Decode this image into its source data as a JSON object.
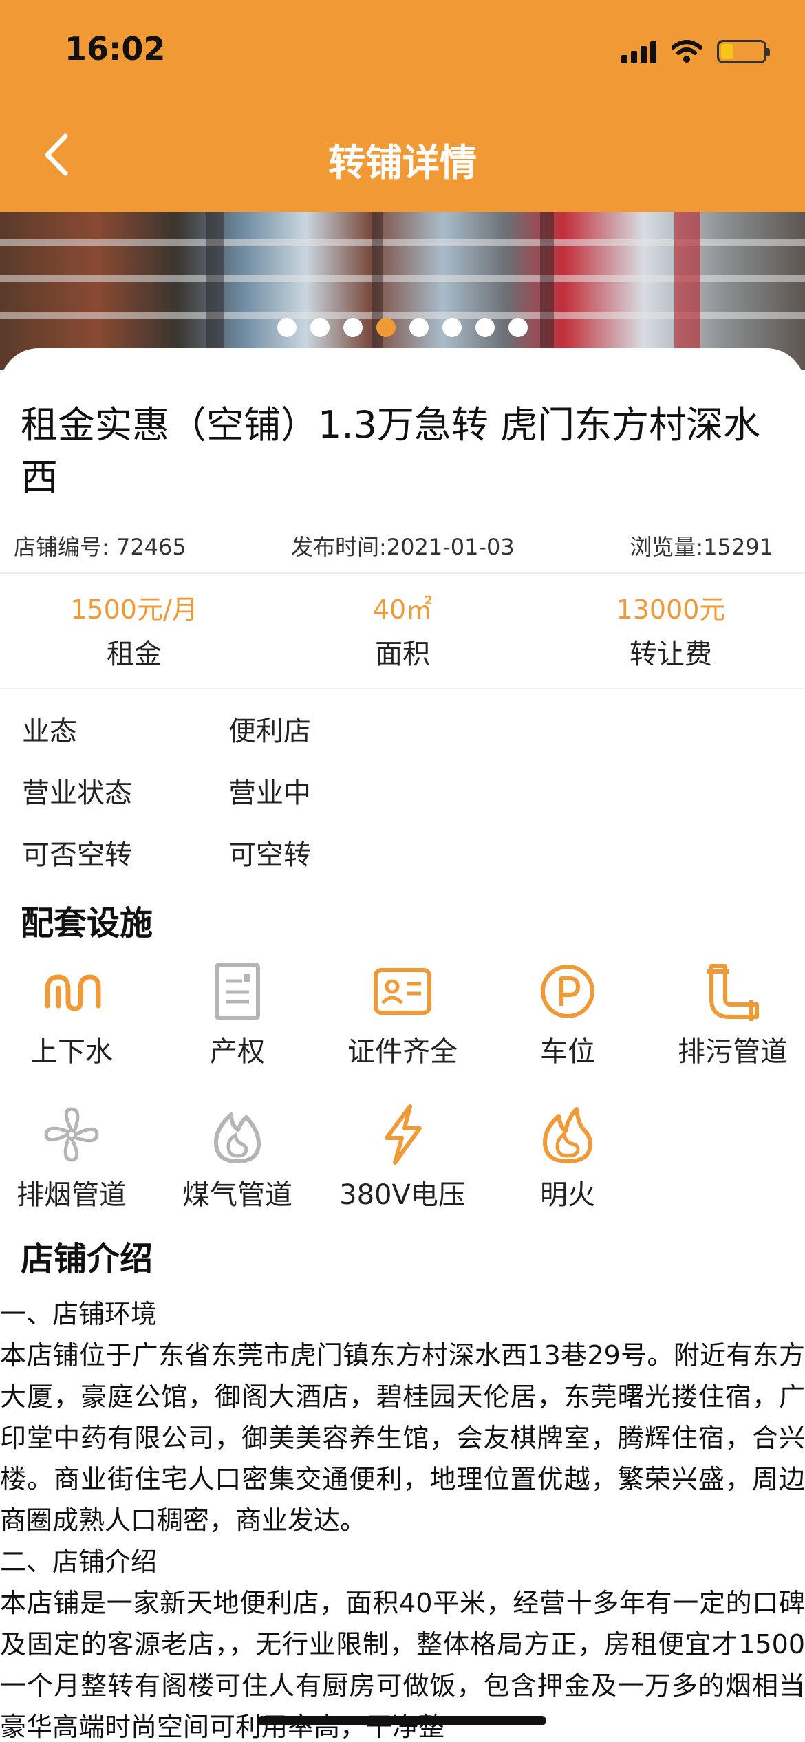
{
  "status_bar": {
    "time": "16:02"
  },
  "header": {
    "title": "转铺详情"
  },
  "carousel": {
    "dot_count": 8,
    "active_index": 3
  },
  "listing": {
    "title": "租金实惠（空铺）1.3万急转 虎门东方村深水西",
    "shop_id": "店铺编号: 72465",
    "publish_time": "发布时间:2021-01-03",
    "views": "浏览量:15291"
  },
  "stats": [
    {
      "value": "1500元/月",
      "label": "租金"
    },
    {
      "value": "40㎡",
      "label": "面积"
    },
    {
      "value": "13000元",
      "label": "转让费"
    }
  ],
  "attributes": [
    {
      "key": "业态",
      "value": "便利店"
    },
    {
      "key": "营业状态",
      "value": "营业中"
    },
    {
      "key": "可否空转",
      "value": "可空转"
    }
  ],
  "facilities": {
    "section_title": "配套设施",
    "items": [
      {
        "label": "上下水",
        "icon": "water-pipe-icon",
        "active": true
      },
      {
        "label": "产权",
        "icon": "document-icon",
        "active": false
      },
      {
        "label": "证件齐全",
        "icon": "id-card-icon",
        "active": true
      },
      {
        "label": "车位",
        "icon": "parking-icon",
        "active": true
      },
      {
        "label": "排污管道",
        "icon": "drain-pipe-icon",
        "active": true
      },
      {
        "label": "排烟管道",
        "icon": "fan-icon",
        "active": false
      },
      {
        "label": "煤气管道",
        "icon": "gas-flame-icon",
        "active": false
      },
      {
        "label": "380V电压",
        "icon": "lightning-icon",
        "active": true
      },
      {
        "label": "明火",
        "icon": "fire-icon",
        "active": true
      }
    ]
  },
  "intro": {
    "section_title": "店铺介绍",
    "paragraphs": [
      "一、店铺环境",
      "本店铺位于广东省东莞市虎门镇东方村深水西13巷29号。附近有东方大厦，豪庭公馆，御阁大酒店，碧桂园天伦居，东莞曙光搂住宿，广印堂中药有限公司，御美美容养生馆，会友棋牌室，腾辉住宿，合兴楼。商业街住宅人口密集交通便利，地理位置优越，繁荣兴盛，周边商圈成熟人口稠密，商业发达。",
      "二、店铺介绍",
      "本店铺是一家新天地便利店，面积40平米，经营十多年有一定的口碑及固定的客源老店，，无行业限制，整体格局方正，房租便宜才1500一个月整转有阁楼可住人有厨房可做饭，包含押金及一万多的烟相当豪华高端时尚空间可利用率高，干净整"
    ]
  },
  "colors": {
    "accent": "#f19a35",
    "inactive_icon": "#b5b5b5"
  }
}
